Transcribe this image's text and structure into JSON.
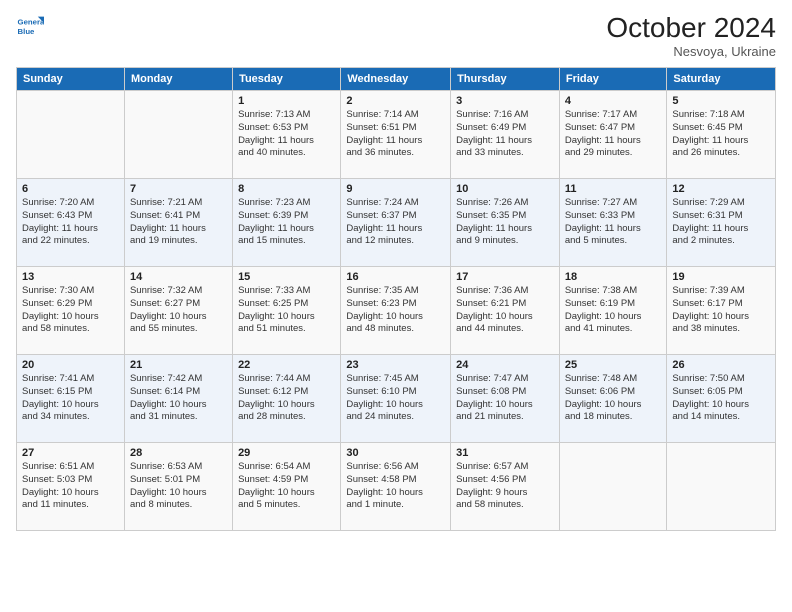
{
  "header": {
    "title": "October 2024",
    "location": "Nesvoya, Ukraine"
  },
  "columns": [
    "Sunday",
    "Monday",
    "Tuesday",
    "Wednesday",
    "Thursday",
    "Friday",
    "Saturday"
  ],
  "weeks": [
    [
      {
        "day": "",
        "info": ""
      },
      {
        "day": "",
        "info": ""
      },
      {
        "day": "1",
        "info": "Sunrise: 7:13 AM\nSunset: 6:53 PM\nDaylight: 11 hours\nand 40 minutes."
      },
      {
        "day": "2",
        "info": "Sunrise: 7:14 AM\nSunset: 6:51 PM\nDaylight: 11 hours\nand 36 minutes."
      },
      {
        "day": "3",
        "info": "Sunrise: 7:16 AM\nSunset: 6:49 PM\nDaylight: 11 hours\nand 33 minutes."
      },
      {
        "day": "4",
        "info": "Sunrise: 7:17 AM\nSunset: 6:47 PM\nDaylight: 11 hours\nand 29 minutes."
      },
      {
        "day": "5",
        "info": "Sunrise: 7:18 AM\nSunset: 6:45 PM\nDaylight: 11 hours\nand 26 minutes."
      }
    ],
    [
      {
        "day": "6",
        "info": "Sunrise: 7:20 AM\nSunset: 6:43 PM\nDaylight: 11 hours\nand 22 minutes."
      },
      {
        "day": "7",
        "info": "Sunrise: 7:21 AM\nSunset: 6:41 PM\nDaylight: 11 hours\nand 19 minutes."
      },
      {
        "day": "8",
        "info": "Sunrise: 7:23 AM\nSunset: 6:39 PM\nDaylight: 11 hours\nand 15 minutes."
      },
      {
        "day": "9",
        "info": "Sunrise: 7:24 AM\nSunset: 6:37 PM\nDaylight: 11 hours\nand 12 minutes."
      },
      {
        "day": "10",
        "info": "Sunrise: 7:26 AM\nSunset: 6:35 PM\nDaylight: 11 hours\nand 9 minutes."
      },
      {
        "day": "11",
        "info": "Sunrise: 7:27 AM\nSunset: 6:33 PM\nDaylight: 11 hours\nand 5 minutes."
      },
      {
        "day": "12",
        "info": "Sunrise: 7:29 AM\nSunset: 6:31 PM\nDaylight: 11 hours\nand 2 minutes."
      }
    ],
    [
      {
        "day": "13",
        "info": "Sunrise: 7:30 AM\nSunset: 6:29 PM\nDaylight: 10 hours\nand 58 minutes."
      },
      {
        "day": "14",
        "info": "Sunrise: 7:32 AM\nSunset: 6:27 PM\nDaylight: 10 hours\nand 55 minutes."
      },
      {
        "day": "15",
        "info": "Sunrise: 7:33 AM\nSunset: 6:25 PM\nDaylight: 10 hours\nand 51 minutes."
      },
      {
        "day": "16",
        "info": "Sunrise: 7:35 AM\nSunset: 6:23 PM\nDaylight: 10 hours\nand 48 minutes."
      },
      {
        "day": "17",
        "info": "Sunrise: 7:36 AM\nSunset: 6:21 PM\nDaylight: 10 hours\nand 44 minutes."
      },
      {
        "day": "18",
        "info": "Sunrise: 7:38 AM\nSunset: 6:19 PM\nDaylight: 10 hours\nand 41 minutes."
      },
      {
        "day": "19",
        "info": "Sunrise: 7:39 AM\nSunset: 6:17 PM\nDaylight: 10 hours\nand 38 minutes."
      }
    ],
    [
      {
        "day": "20",
        "info": "Sunrise: 7:41 AM\nSunset: 6:15 PM\nDaylight: 10 hours\nand 34 minutes."
      },
      {
        "day": "21",
        "info": "Sunrise: 7:42 AM\nSunset: 6:14 PM\nDaylight: 10 hours\nand 31 minutes."
      },
      {
        "day": "22",
        "info": "Sunrise: 7:44 AM\nSunset: 6:12 PM\nDaylight: 10 hours\nand 28 minutes."
      },
      {
        "day": "23",
        "info": "Sunrise: 7:45 AM\nSunset: 6:10 PM\nDaylight: 10 hours\nand 24 minutes."
      },
      {
        "day": "24",
        "info": "Sunrise: 7:47 AM\nSunset: 6:08 PM\nDaylight: 10 hours\nand 21 minutes."
      },
      {
        "day": "25",
        "info": "Sunrise: 7:48 AM\nSunset: 6:06 PM\nDaylight: 10 hours\nand 18 minutes."
      },
      {
        "day": "26",
        "info": "Sunrise: 7:50 AM\nSunset: 6:05 PM\nDaylight: 10 hours\nand 14 minutes."
      }
    ],
    [
      {
        "day": "27",
        "info": "Sunrise: 6:51 AM\nSunset: 5:03 PM\nDaylight: 10 hours\nand 11 minutes."
      },
      {
        "day": "28",
        "info": "Sunrise: 6:53 AM\nSunset: 5:01 PM\nDaylight: 10 hours\nand 8 minutes."
      },
      {
        "day": "29",
        "info": "Sunrise: 6:54 AM\nSunset: 4:59 PM\nDaylight: 10 hours\nand 5 minutes."
      },
      {
        "day": "30",
        "info": "Sunrise: 6:56 AM\nSunset: 4:58 PM\nDaylight: 10 hours\nand 1 minute."
      },
      {
        "day": "31",
        "info": "Sunrise: 6:57 AM\nSunset: 4:56 PM\nDaylight: 9 hours\nand 58 minutes."
      },
      {
        "day": "",
        "info": ""
      },
      {
        "day": "",
        "info": ""
      }
    ]
  ]
}
